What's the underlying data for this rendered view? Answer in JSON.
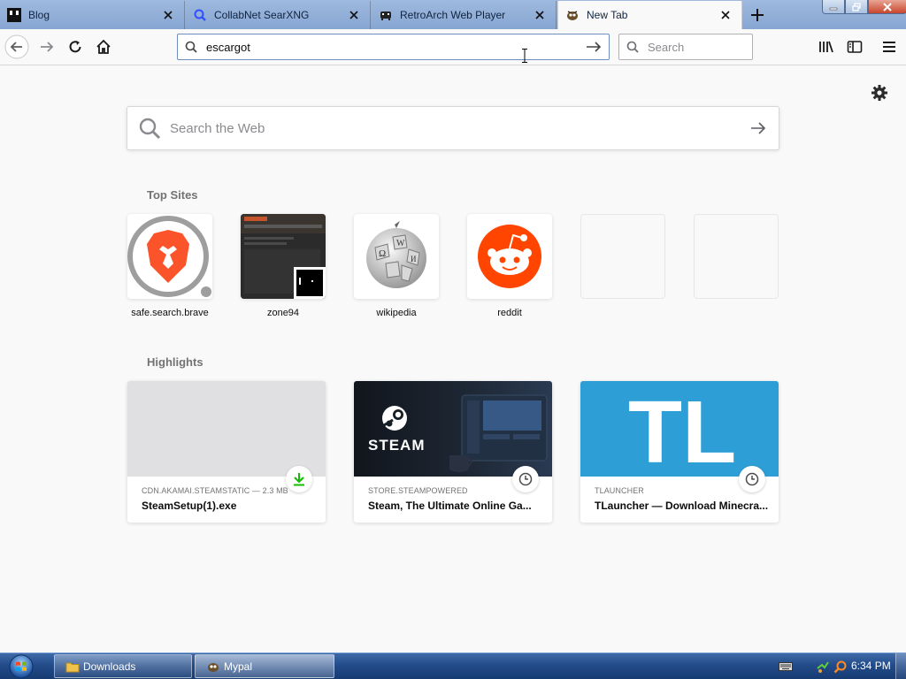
{
  "tabs": [
    {
      "title": "Blog",
      "favicon": "square-dark-icon"
    },
    {
      "title": "CollabNet SearXNG",
      "favicon": "searxng-icon"
    },
    {
      "title": "RetroArch Web Player",
      "favicon": "invader-icon"
    },
    {
      "title": "New Tab",
      "favicon": "mypal-icon",
      "active": true
    }
  ],
  "navbar": {
    "url_value": "escargot",
    "search_placeholder": "Search"
  },
  "content": {
    "web_search_placeholder": "Search the Web",
    "top_sites_title": "Top Sites",
    "highlights_title": "Highlights"
  },
  "top_sites": [
    {
      "label": "safe.search.brave",
      "icon": "brave-lion-icon"
    },
    {
      "label": "zone94",
      "icon": "zone94-thumbnail"
    },
    {
      "label": "wikipedia",
      "icon": "wikipedia-globe-icon"
    },
    {
      "label": "reddit",
      "icon": "reddit-alien-icon"
    },
    {
      "label": "",
      "icon": "empty-tile"
    },
    {
      "label": "",
      "icon": "empty-tile"
    }
  ],
  "highlights": [
    {
      "meta": "CDN.AKAMAI.STEAMSTATIC — 2.3 MB",
      "title": "SteamSetup(1).exe",
      "badge": "download-icon"
    },
    {
      "meta": "STORE.STEAMPOWERED",
      "title": "Steam, The Ultimate Online Ga...",
      "badge": "clock-icon",
      "brand": "STEAM"
    },
    {
      "meta": "TLAUNCHER",
      "title": "TLauncher — Download Minecra...",
      "badge": "clock-icon",
      "brand": "TL"
    }
  ],
  "taskbar": {
    "items": [
      {
        "label": "Downloads",
        "icon": "folder-icon"
      },
      {
        "label": "Mypal",
        "icon": "mypal-icon",
        "active": true
      }
    ],
    "time": "6:34 PM"
  },
  "colors": {
    "accent": "#0a84ff",
    "reddit": "#ff4500",
    "brave": "#fb542b",
    "tlauncher": "#2e9fd6",
    "steam": "#171d25",
    "download": "#12bc00"
  }
}
